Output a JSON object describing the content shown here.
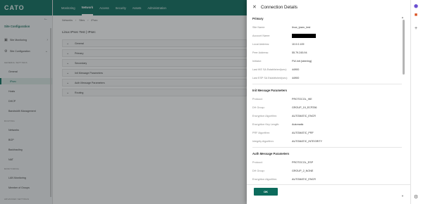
{
  "brand": {
    "name": "CATO"
  },
  "sidebar": {
    "title": "Site Configuration",
    "back_icon": "arrow-left-icon",
    "groups": [
      {
        "label": "Site Monitoring",
        "icon": "monitor-icon"
      },
      {
        "label": "Site Configuration",
        "icon": "gear-icon"
      }
    ],
    "sections": [
      {
        "label": "GENERAL SETTINGS",
        "items": [
          "General",
          "IPsec",
          "Hosts",
          "DHCP",
          "Bandwidth Management"
        ]
      },
      {
        "label": "ROUTING",
        "items": [
          "Networks",
          "BGP",
          "Backhauling",
          "NAT"
        ]
      },
      {
        "label": "MONITORING",
        "items": [
          "LAN Monitoring",
          "Member of Groups"
        ]
      },
      {
        "label": "ADVANCED SETTINGS",
        "items": []
      }
    ],
    "active_item": "IPsec"
  },
  "topnav": {
    "items": [
      "Monitoring",
      "Network",
      "Access",
      "Security",
      "Assets",
      "Administration"
    ],
    "active": "Network"
  },
  "breadcrumb": [
    "Networks",
    "Sites",
    "IPsec"
  ],
  "page": {
    "title": "Linux IPsec Test | IPsec",
    "panels": [
      "General",
      "Primary",
      "Secondary",
      "Init Message Parameters",
      "Auth Message Parameters",
      "Routing"
    ]
  },
  "dialog": {
    "title": "Connection Details",
    "sections": [
      {
        "title": "Primary",
        "rows": [
          {
            "key": "Site Name:",
            "value": "linux_ipsec_test"
          },
          {
            "key": "Account Name:",
            "value": "",
            "redacted": true
          },
          {
            "key": "Local Address:",
            "value": "10.0.0.109"
          },
          {
            "key": "Peer Address:",
            "value": "55.79.245.94"
          },
          {
            "key": "Initiator:",
            "value": "FW-init (steering)"
          },
          {
            "key": "Last IKE SA Established(sec):",
            "value": "44900"
          },
          {
            "key": "Last ESP SA Established(sec):",
            "value": "44900"
          }
        ]
      },
      {
        "title": "Init Message Parameters",
        "rows": [
          {
            "key": "Protocol:",
            "value": "PROTOCOL_IKE"
          },
          {
            "key": "DH Group:",
            "value": "GROUP_19_ECP256"
          },
          {
            "key": "Encryption Algorithm:",
            "value": "AUTOMATIC_ENCR"
          },
          {
            "key": "Encryption Key Length:",
            "value": "Automatic"
          },
          {
            "key": "PRF Algorithm:",
            "value": "AUTOMATIC_PRF"
          },
          {
            "key": "Integrity Algorithm:",
            "value": "AUTOMATIC_INTEGRITY"
          }
        ]
      },
      {
        "title": "Auth Message Parameters",
        "rows": [
          {
            "key": "Protocol:",
            "value": "PROTOCOL_ESP"
          },
          {
            "key": "DH Group:",
            "value": "GROUP_2_NONE"
          },
          {
            "key": "Encryption Algorithm:",
            "value": "AUTOMATIC_ENCR"
          }
        ]
      }
    ],
    "ok_label": "OK"
  },
  "colors": {
    "brand": "#0c6b5c",
    "overlay": "rgba(40,45,48,0.42)",
    "redaction": "#000000"
  },
  "right_rail": {
    "icons": [
      "puzzle-icon",
      "office-icon",
      "plus-icon",
      "settings-icon"
    ]
  }
}
